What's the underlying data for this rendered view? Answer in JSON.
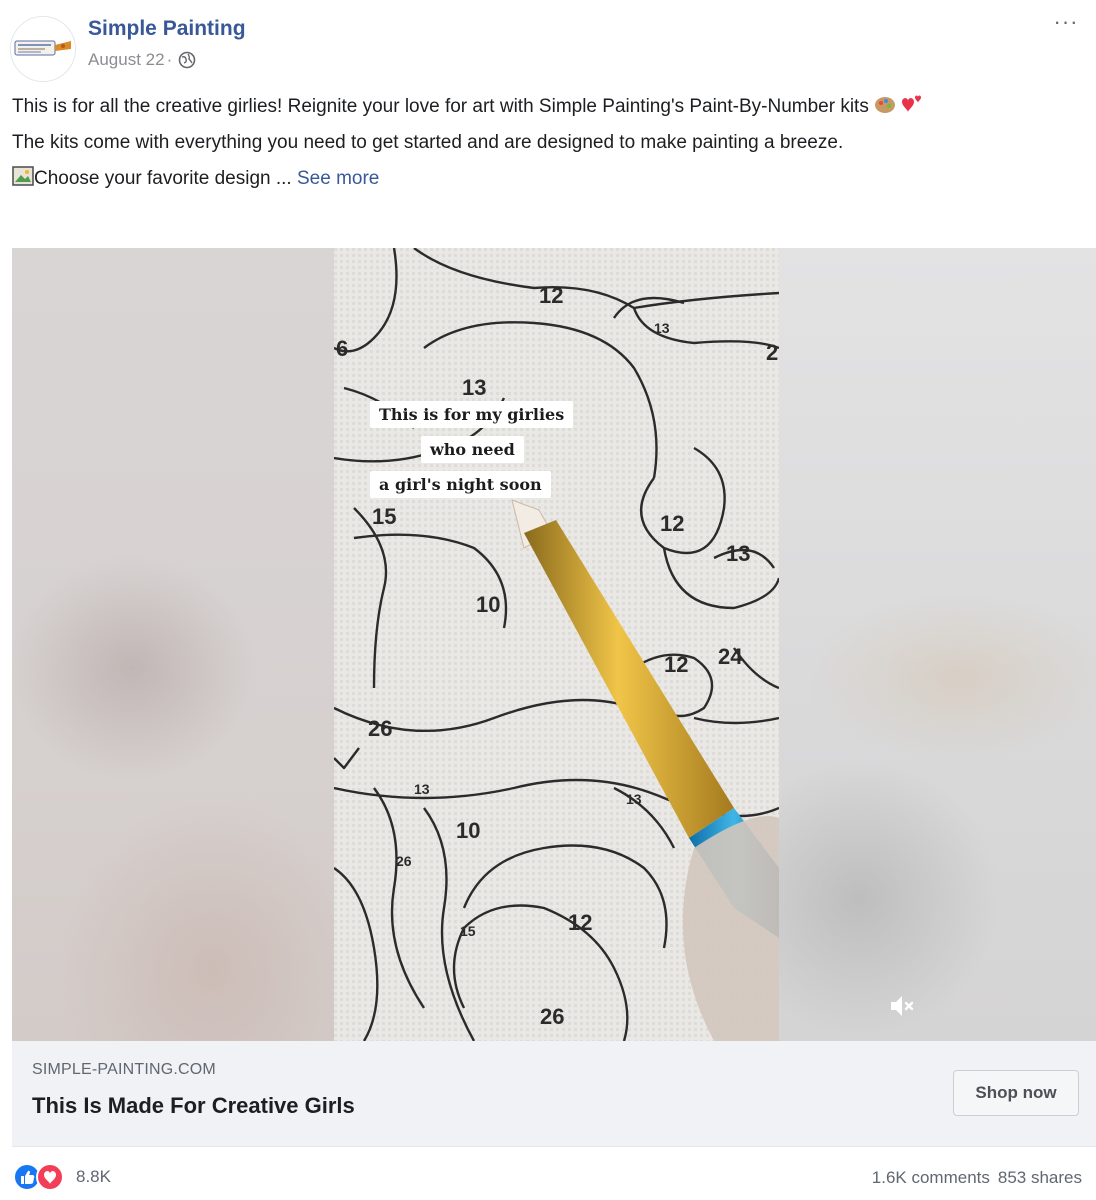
{
  "post": {
    "page_name": "Simple Painting",
    "date": "August 22",
    "date_separator": " · ",
    "more_label": "···",
    "caption": {
      "line1": "This is for all the creative girlies! Reignite your love for art with Simple Painting's Paint-By-Number kits",
      "line2": "The kits come with everything you need to get started and are designed to make painting a breeze.",
      "line3": "Choose your favorite design ...",
      "see_more": "See more"
    }
  },
  "video": {
    "overlay_lines": [
      "This is for my girlies",
      "who need",
      "a girl's night soon"
    ],
    "canvas_numbers": [
      "12",
      "13",
      "6",
      "2",
      "13",
      "12",
      "15",
      "12",
      "13",
      "10",
      "12",
      "24",
      "26",
      "13",
      "13",
      "10",
      "26",
      "15",
      "12",
      "26"
    ]
  },
  "link_card": {
    "domain": "SIMPLE-PAINTING.COM",
    "title": "This Is Made For Creative Girls",
    "cta": "Shop now"
  },
  "engagement": {
    "reaction_count": "8.8K",
    "comments": "1.6K comments",
    "shares": "853 shares"
  },
  "colors": {
    "brand_link": "#385898",
    "like_blue": "#1877f2",
    "love_red": "#f33e58",
    "muted_text": "#606770"
  }
}
